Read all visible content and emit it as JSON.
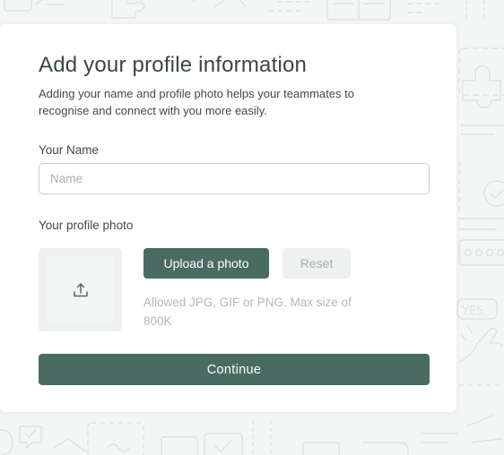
{
  "dialog": {
    "title": "Add your profile information",
    "subtitle": "Adding your name and profile photo helps your teammates to recognise and connect with you more easily."
  },
  "name_field": {
    "label": "Your Name",
    "placeholder": "Name",
    "value": ""
  },
  "photo": {
    "label": "Your profile photo",
    "icon": "upload-icon",
    "upload_label": "Upload a photo",
    "reset_label": "Reset",
    "help_text": "Allowed JPG, GIF or PNG. Max size of 800K"
  },
  "actions": {
    "continue_label": "Continue"
  },
  "colors": {
    "primary": "#4a6b62",
    "background": "#f4f6f5",
    "card": "#ffffff",
    "pattern_stroke": "#dde3e0"
  },
  "background_pattern_icons": [
    "puzzle-icon",
    "book-icon",
    "check-circle-icon",
    "chat-icon",
    "keyboard-icon",
    "yes-tag-icon",
    "hand-icon"
  ]
}
